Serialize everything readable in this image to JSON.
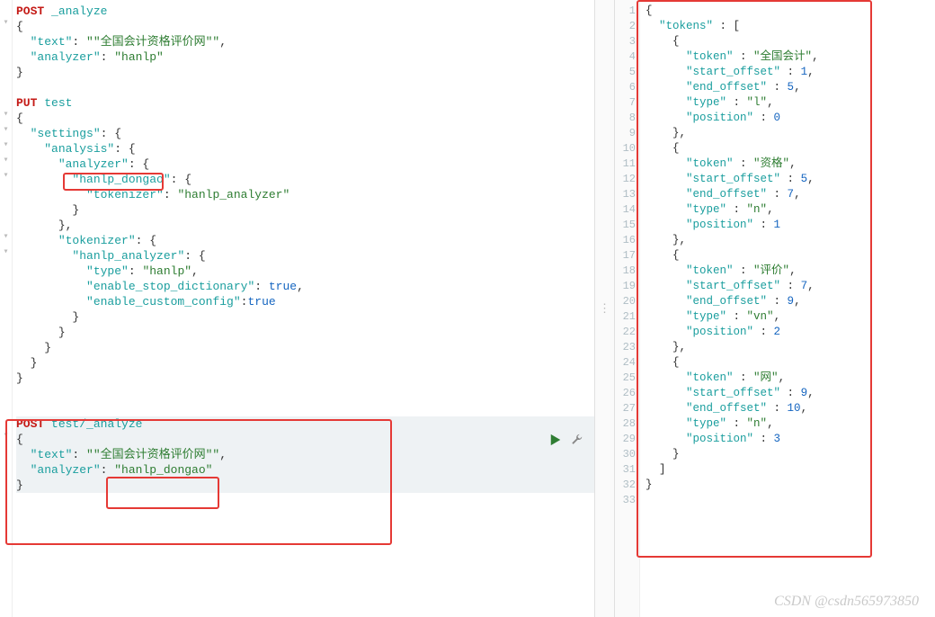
{
  "watermark": "CSDN @csdn565973850",
  "left": {
    "req1": {
      "method": "POST",
      "path": "_analyze",
      "body_text_key": "\"text\"",
      "body_text_val": "\"\"全国会计资格评价网\"\"",
      "body_analyzer_key": "\"analyzer\"",
      "body_analyzer_val": "\"hanlp\""
    },
    "req2": {
      "method": "PUT",
      "path": "test",
      "settings_key": "\"settings\"",
      "analysis_key": "\"analysis\"",
      "analyzer_key": "\"analyzer\"",
      "hanlp_dongao_key": "\"hanlp_dongao\"",
      "tokenizer_key_inner": "\"tokenizer\"",
      "tokenizer_val_inner": "\"hanlp_analyzer\"",
      "tokenizer_key": "\"tokenizer\"",
      "hanlp_analyzer_key": "\"hanlp_analyzer\"",
      "type_key": "\"type\"",
      "type_val": "\"hanlp\"",
      "enable_stop_key": "\"enable_stop_dictionary\"",
      "enable_stop_val": "true",
      "enable_custom_key": "\"enable_custom_config\"",
      "enable_custom_val": "true"
    },
    "req3": {
      "method": "POST",
      "path": "test/_analyze",
      "body_text_key": "\"text\"",
      "body_text_val": "\"\"全国会计资格评价网\"\"",
      "body_analyzer_key": "\"analyzer\"",
      "body_analyzer_val": "\"hanlp_dongao\""
    }
  },
  "right": {
    "tokens_key": "\"tokens\"",
    "tokens": [
      {
        "token": "\"全国会计\"",
        "start_offset": "1",
        "end_offset": "5",
        "type": "\"l\"",
        "position": "0"
      },
      {
        "token": "\"资格\"",
        "start_offset": "5",
        "end_offset": "7",
        "type": "\"n\"",
        "position": "1"
      },
      {
        "token": "\"评价\"",
        "start_offset": "7",
        "end_offset": "9",
        "type": "\"vn\"",
        "position": "2"
      },
      {
        "token": "\"网\"",
        "start_offset": "9",
        "end_offset": "10",
        "type": "\"n\"",
        "position": "3"
      }
    ],
    "labels": {
      "token": "\"token\"",
      "start_offset": "\"start_offset\"",
      "end_offset": "\"end_offset\"",
      "type": "\"type\"",
      "position": "\"position\""
    },
    "line_numbers": [
      "1",
      "2",
      "3",
      "4",
      "5",
      "6",
      "7",
      "8",
      "9",
      "10",
      "11",
      "12",
      "13",
      "14",
      "15",
      "16",
      "17",
      "18",
      "19",
      "20",
      "21",
      "22",
      "23",
      "24",
      "25",
      "26",
      "27",
      "28",
      "29",
      "30",
      "31",
      "32",
      "33"
    ]
  }
}
